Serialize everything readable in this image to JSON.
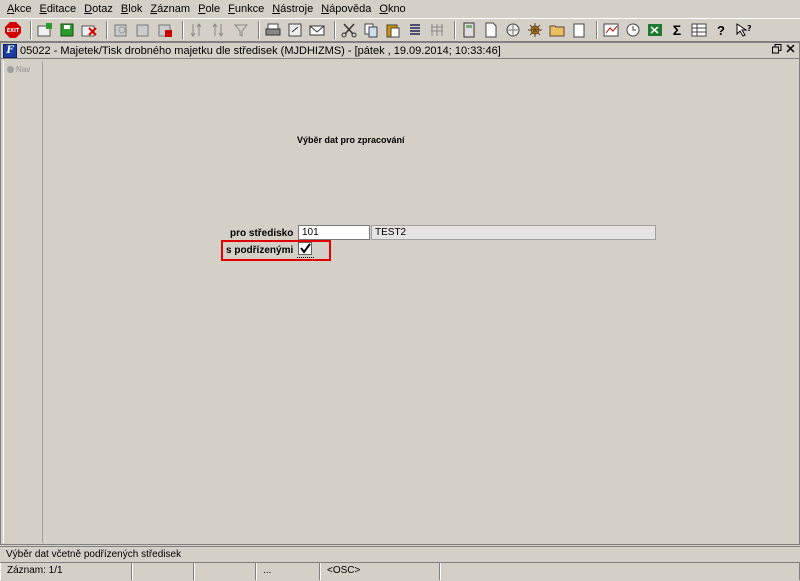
{
  "menu": [
    {
      "label": "Akce",
      "u": "A",
      "rest": "kce"
    },
    {
      "label": "Editace",
      "u": "E",
      "rest": "ditace"
    },
    {
      "label": "Dotaz",
      "u": "D",
      "rest": "otaz"
    },
    {
      "label": "Blok",
      "u": "B",
      "rest": "lok"
    },
    {
      "label": "Záznam",
      "u": "Z",
      "rest": "áznam"
    },
    {
      "label": "Pole",
      "u": "P",
      "rest": "ole"
    },
    {
      "label": "Funkce",
      "u": "F",
      "rest": "unkce"
    },
    {
      "label": "Nástroje",
      "u": "N",
      "rest": "ástroje"
    },
    {
      "label": "Nápověda",
      "u": "N",
      "rest": "ápověda"
    },
    {
      "label": "Okno",
      "u": "O",
      "rest": "kno"
    }
  ],
  "toolbar": {
    "exit_label": "EXIT",
    "sigma_label": "Σ",
    "help_label": "?"
  },
  "window": {
    "title": "05022 - Majetek/Tisk drobného majetku dle středisek (MJDHIZMS) - [pátek  , 19.09.2014; 10:33:46]",
    "app_icon_label": "F",
    "nav_label": "Nav"
  },
  "form": {
    "section_title": "Výběr dat pro zpracování",
    "stredisko_label": "pro středisko",
    "stredisko_code": "101",
    "stredisko_name": "TEST2",
    "podrizene_label": "s podřízenými",
    "podrizene_checked": true
  },
  "hint_text": "Výběr dat včetně podřízených středisek",
  "status": {
    "record": "Záznam: 1/1",
    "ellipsis": "...",
    "mode": "<OSC>"
  },
  "colors": {
    "highlight": "#e00000",
    "background": "#d4d0c8"
  }
}
